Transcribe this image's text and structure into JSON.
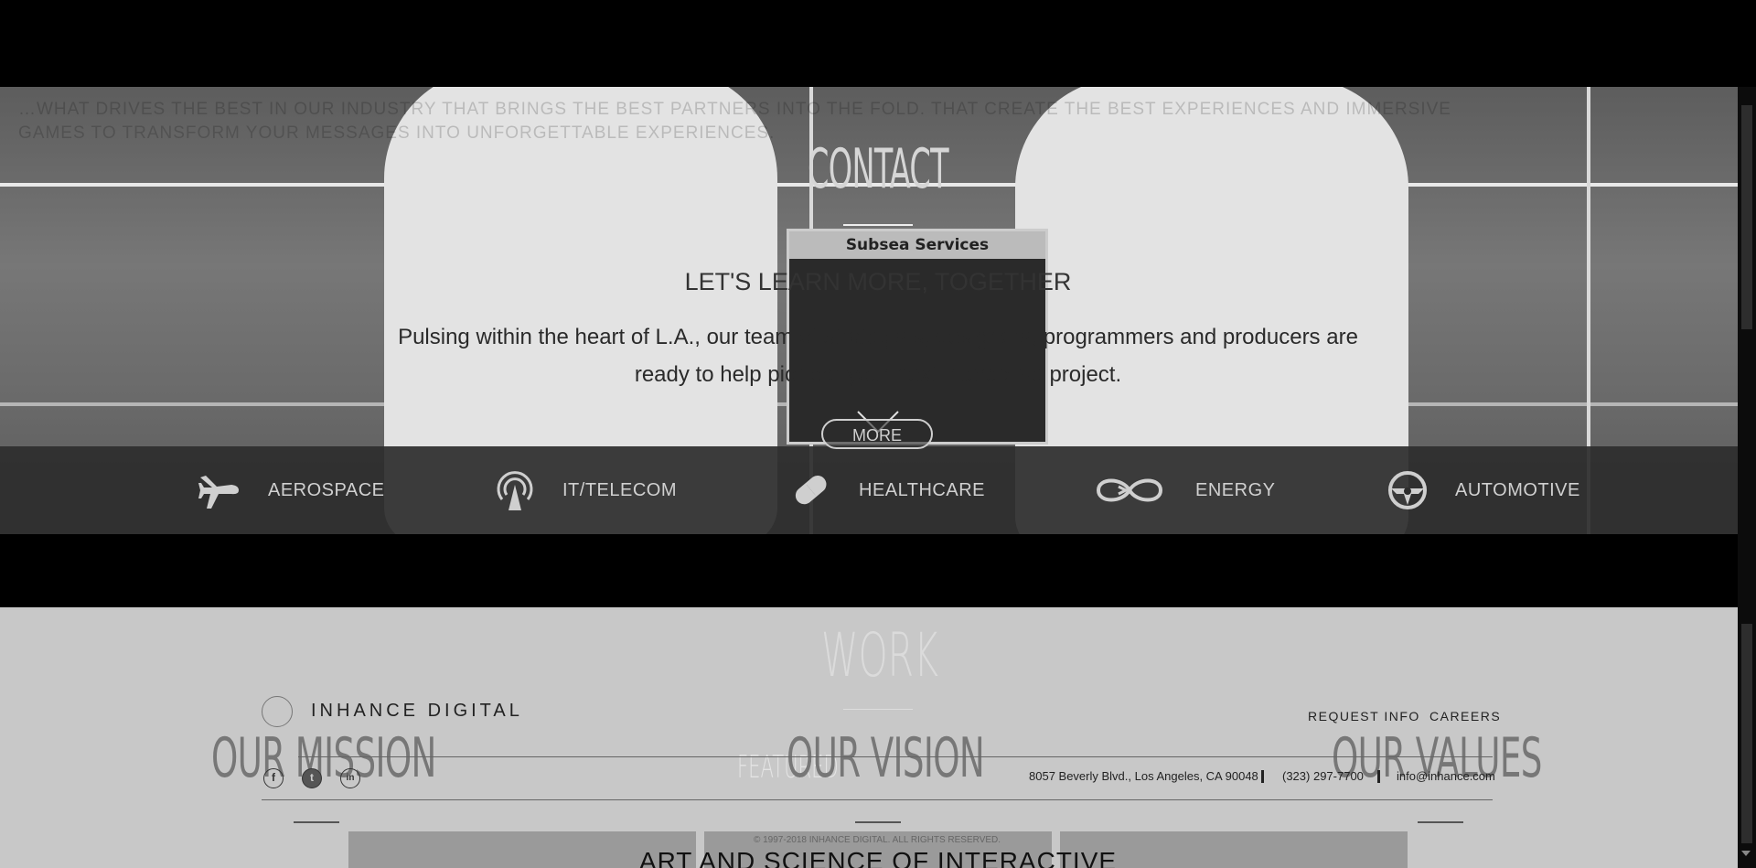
{
  "hero": {
    "ghost_text": "…WHAT DRIVES THE BEST IN OUR INDUSTRY THAT BRINGS THE BEST PARTNERS INTO THE FOLD. THAT CREATE THE BEST EXPERIENCES AND IMMERSIVE GAMES TO TRANSFORM YOUR MESSAGES INTO UNFORGETTABLE EXPERIENCES.",
    "panel_title": "Subsea Services",
    "title": "CONTACT",
    "subtitle": "LET'S LEARN MORE, TOGETHER",
    "body_line1": "Pulsing within the heart of L.A., our team of strategists, designers, programmers and producers are",
    "body_line2": "ready to help pioneer your next interactive project."
  },
  "industries": [
    {
      "label": "AEROSPACE",
      "icon": "airplane-icon"
    },
    {
      "label": "IT/TELECOM",
      "icon": "broadcast-tower-icon"
    },
    {
      "label": "HEALTHCARE",
      "icon": "pill-capsule-icon"
    },
    {
      "label": "ENERGY",
      "icon": "infinity-energy-icon"
    },
    {
      "label": "AUTOMOTIVE",
      "icon": "steering-wheel-icon"
    }
  ],
  "more_label": "MORE",
  "lower": {
    "ghost_work": "WORK",
    "ghost_featured": "FEATURED",
    "mission": "OUR MISSION",
    "vision": "OUR VISION",
    "values": "OUR VALUES",
    "art_line": "ART AND SCIENCE OF INTERACTIVE"
  },
  "footer": {
    "brand": "INHANCE DIGITAL",
    "nav": [
      "REQUEST INFO",
      "CAREERS"
    ],
    "social": [
      {
        "glyph": "f",
        "icon": "facebook-icon"
      },
      {
        "glyph": "t",
        "icon": "twitter-icon"
      },
      {
        "glyph": "in",
        "icon": "linkedin-icon"
      }
    ],
    "address": "8057 Beverly Blvd., Los Angeles, CA 90048",
    "phone": "(323) 297-7700",
    "email": "info@inhance.com",
    "copyright": "© 1997-2018 INHANCE DIGITAL. ALL RIGHTS RESERVED."
  },
  "colors": {
    "page_background": "#000000",
    "industry_bar": "#2d2d2d",
    "lower_section": "#c8c8c8"
  }
}
